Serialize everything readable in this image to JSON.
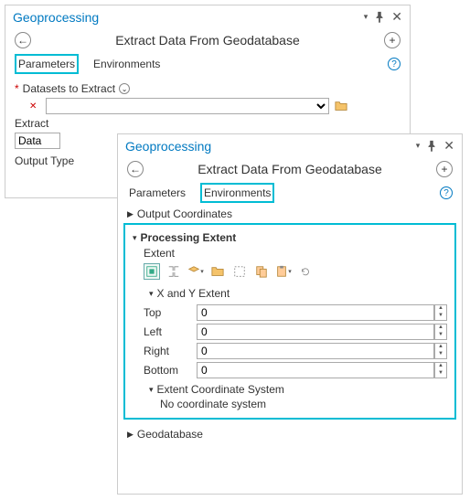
{
  "panels": {
    "back": {
      "title": "Geoprocessing",
      "heading": "Extract Data From Geodatabase",
      "tabs": {
        "parameters": "Parameters",
        "environments": "Environments"
      },
      "datasets_label": "Datasets to Extract",
      "extract_label": "Extract",
      "extract_value": "Data",
      "output_type_label": "Output Type"
    },
    "front": {
      "title": "Geoprocessing",
      "heading": "Extract Data From Geodatabase",
      "tabs": {
        "parameters": "Parameters",
        "environments": "Environments"
      },
      "sections": {
        "output_coords": "Output Coordinates",
        "processing_extent": "Processing Extent",
        "geodatabase": "Geodatabase"
      },
      "extent_label": "Extent",
      "xy_extent": "X and Y Extent",
      "coords": {
        "top": {
          "label": "Top",
          "value": "0"
        },
        "left": {
          "label": "Left",
          "value": "0"
        },
        "right": {
          "label": "Right",
          "value": "0"
        },
        "bottom": {
          "label": "Bottom",
          "value": "0"
        }
      },
      "ecs_label": "Extent Coordinate System",
      "ecs_value": "No coordinate system"
    }
  }
}
